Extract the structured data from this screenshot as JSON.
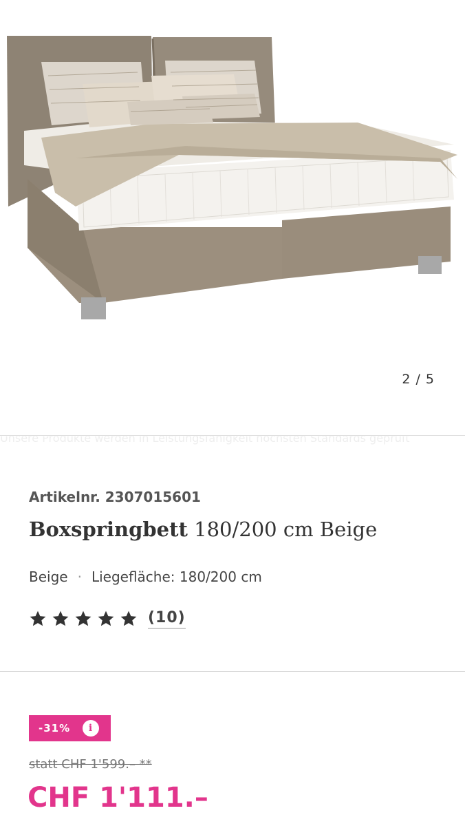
{
  "gallery": {
    "image_alt": "Boxspringbett in Beige",
    "counter": "2 / 5",
    "ghost_text": "Unsere Produkte werden in Leistungsfähigkeit höchsten Standards geprüft"
  },
  "product": {
    "article_number": "Artikelnr. 2307015601",
    "title_bold": "Boxspringbett",
    "title_rest": " 180/200 cm Beige",
    "variant_color": "Beige",
    "variant_separator": "·",
    "variant_size": "Liegefläche: 180/200 cm",
    "rating": {
      "stars": 5,
      "max": 5,
      "count_label": "(10)"
    }
  },
  "pricing": {
    "discount_label": "-31%",
    "info_label": "i",
    "old_price": "statt CHF 1'599.– **",
    "new_price": "CHF 1'111.–",
    "accent_color": "#e2358c"
  }
}
